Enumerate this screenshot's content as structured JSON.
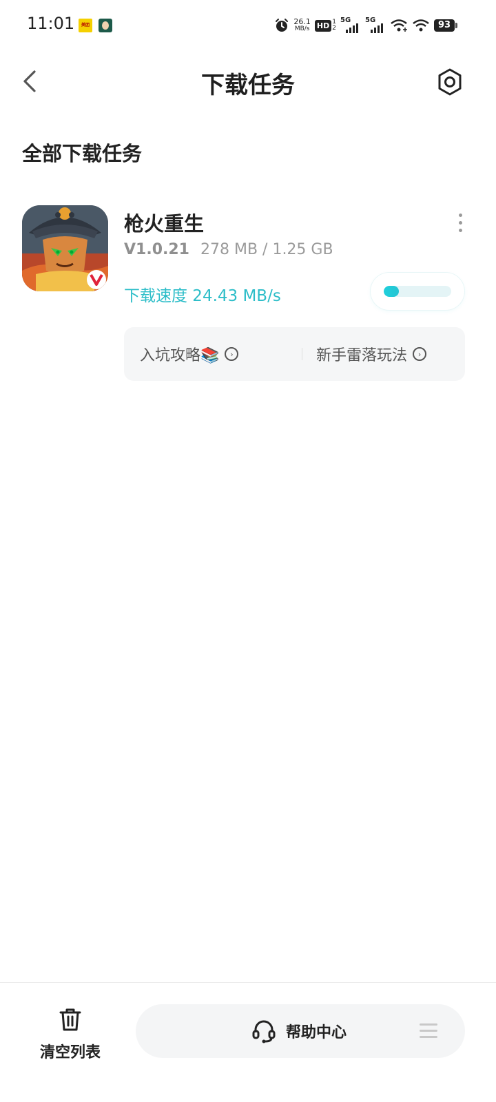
{
  "status_bar": {
    "time": "11:01",
    "net_speed_value": "26.1",
    "net_speed_unit": "MB/s",
    "hd_label": "HD",
    "hd_sub_top": "1",
    "hd_sub_bottom": "2",
    "sim1_label": "5G",
    "sim2_label": "5G",
    "battery": "93",
    "notif1_text": "美团",
    "icons": [
      "alarm-icon",
      "wifi-calling-icon",
      "wifi-icon",
      "battery-icon"
    ]
  },
  "header": {
    "title": "下载任务",
    "back_icon": "chevron-left-icon",
    "settings_icon": "hexagon-settings-icon"
  },
  "section_title": "全部下载任务",
  "task": {
    "name": "枪火重生",
    "version": "V1.0.21",
    "size": "278 MB / 1.25 GB",
    "speed": "下载速度 24.43 MB/s",
    "progress_fraction": 0.22,
    "guides": [
      {
        "label": "入坑攻略📚"
      },
      {
        "label": "新手雷落玩法"
      }
    ]
  },
  "bottom": {
    "clear_label": "清空列表",
    "help_label": "帮助中心"
  },
  "colors": {
    "accent": "#2cbdc8",
    "text_primary": "#1f1f1f",
    "text_secondary": "#9a9a9a",
    "card_bg": "#f5f6f7"
  }
}
